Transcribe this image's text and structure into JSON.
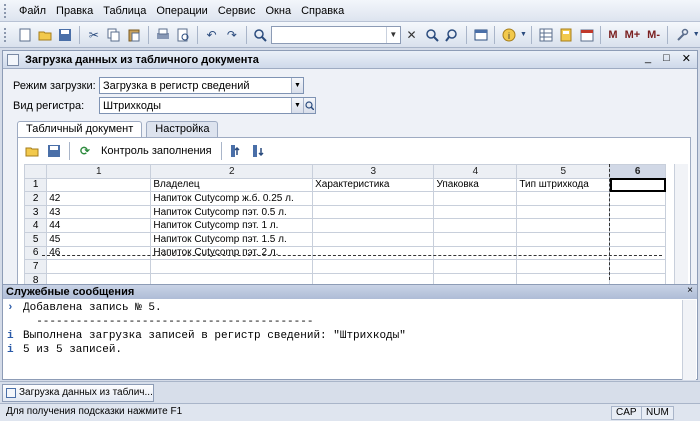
{
  "menu": {
    "items": [
      "Файл",
      "Правка",
      "Таблица",
      "Операции",
      "Сервис",
      "Окна",
      "Справка"
    ]
  },
  "toolbar": {
    "search_value": "",
    "m_label": "M",
    "mplus_label": "M+",
    "mminus_label": "M-"
  },
  "window": {
    "title": "Загрузка данных из табличного документа",
    "minimize_label": "_",
    "maximize_label": "□",
    "close_label": "✕"
  },
  "form": {
    "mode_label": "Режим загрузки:",
    "mode_value": "Загрузка в регистр сведений",
    "register_label": "Вид регистра:",
    "register_value": "Штрихкоды"
  },
  "tabs": [
    "Табличный документ",
    "Настройка"
  ],
  "sheet_toolbar": {
    "check_label": "Контроль заполнения"
  },
  "grid": {
    "columns": [
      "",
      "1",
      "2",
      "3",
      "4",
      "5",
      "6"
    ],
    "rows": [
      [
        "1",
        "",
        "Владелец",
        "Характеристика",
        "Упаковка",
        "Тип штрихкода",
        ""
      ],
      [
        "2",
        "42",
        "Напиток Cutycomp ж.б. 0.25 л.",
        "",
        "",
        "",
        ""
      ],
      [
        "3",
        "43",
        "Напиток Cutycomp пэт. 0.5 л.",
        "",
        "",
        "",
        ""
      ],
      [
        "4",
        "44",
        "Напиток Cutycomp пэт. 1 л.",
        "",
        "",
        "",
        ""
      ],
      [
        "5",
        "45",
        "Напиток Cutycomp пэт. 1.5 л.",
        "",
        "",
        "",
        ""
      ],
      [
        "6",
        "46",
        "Напиток Cutycomp пэт. 2 л.",
        "",
        "",
        "",
        ""
      ],
      [
        "7",
        "",
        "",
        "",
        "",
        "",
        ""
      ],
      [
        "8",
        "",
        "",
        "",
        "",
        "",
        ""
      ]
    ]
  },
  "messages": {
    "title": "Служебные сообщения",
    "close_label": "×",
    "lines": [
      {
        "mark": "›",
        "text": "Добавлена запись № 5."
      },
      {
        "mark": "",
        "text": "  ------------------------------------------"
      },
      {
        "mark": "i",
        "text": "Выполнена загрузка записей в регистр сведений: \"Штрихкоды\""
      },
      {
        "mark": "i",
        "text": "5 из 5 записей."
      }
    ]
  },
  "taskbar": {
    "item_label": "Загрузка данных из таблич..."
  },
  "status": {
    "hint": "Для получения подсказки нажмите F1",
    "cap": "CAP",
    "num": "NUM"
  }
}
